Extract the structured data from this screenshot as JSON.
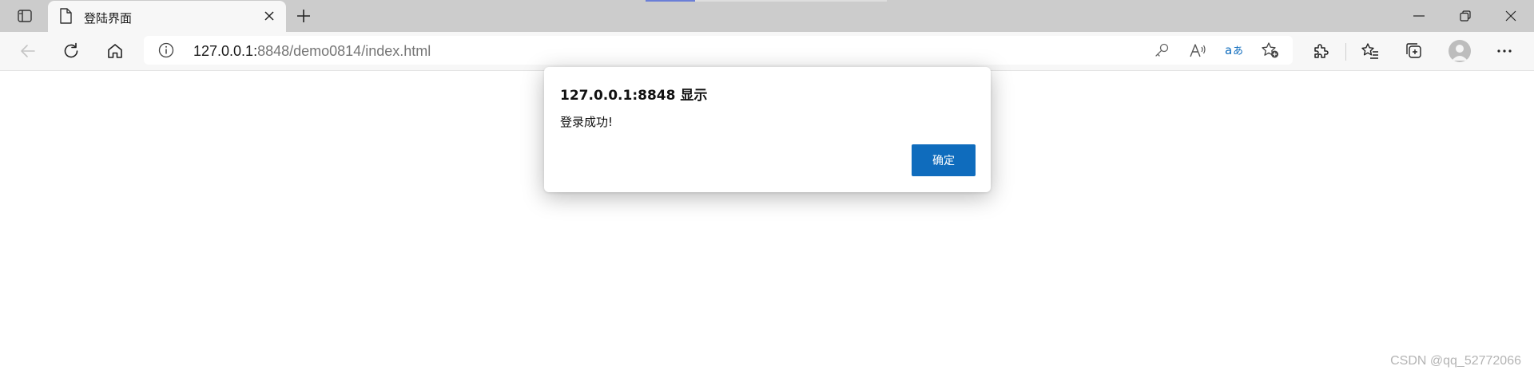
{
  "tab": {
    "title": "登陆界面"
  },
  "address_bar": {
    "url_host": "127.0.0.1:",
    "url_rest": "8848/demo0814/index.html"
  },
  "dialog": {
    "title": "127.0.0.1:8848 显示",
    "message": "登录成功!",
    "ok_label": "确定"
  },
  "watermark": "CSDN @qq_52772066",
  "icons": [
    "tab-actions-icon",
    "page-icon",
    "close-icon",
    "new-tab-icon",
    "minimize-icon",
    "restore-icon",
    "window-close-icon",
    "back-icon",
    "refresh-icon",
    "home-icon",
    "info-icon",
    "key-icon",
    "read-aloud-icon",
    "translate-icon",
    "add-favorite-icon",
    "extensions-icon",
    "favorites-icon",
    "collections-icon",
    "profile-icon",
    "more-icon"
  ],
  "colors": {
    "accent": "#0f6cbd",
    "tabbar": "#cccccc",
    "toolbar": "#f7f7f7"
  }
}
